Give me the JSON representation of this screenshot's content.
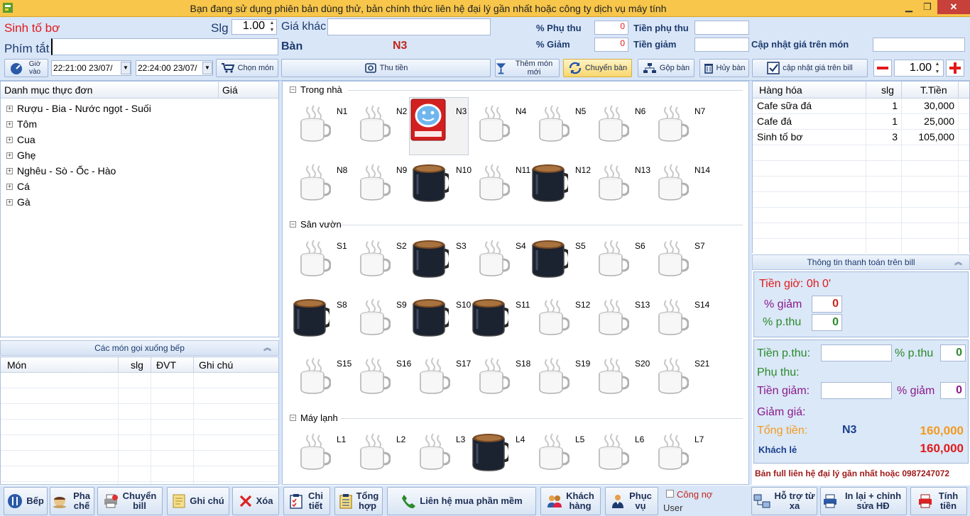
{
  "window": {
    "title": "Bạn đang sử dụng phiên bản dùng thử, bản chính thức liên hệ đại lý gần nhất hoặc công ty dịch vụ máy tính"
  },
  "order_entry": {
    "item_name": "Sinh tố bơ",
    "qty_label": "Slg",
    "qty_value": "1.00",
    "hotkey_label": "Phím tắt",
    "hotkey_value": "",
    "other_price_label": "Giá khác",
    "other_price_value": "",
    "table_label": "Bàn",
    "table_value": "N3",
    "surcharge_pct_label": "% Phụ thu",
    "surcharge_pct_value": "0",
    "discount_pct_label": "% Giảm",
    "discount_pct_value": "0",
    "surcharge_amount_label": "Tiền phụ thu",
    "discount_amount_label": "Tiền  giảm",
    "update_price_label": "Cập nhật giá trên món",
    "checkin_label": "Giờ vào",
    "time_in": "22:21:00 23/07/",
    "time_out": "22:24:00 23/07/",
    "qty_right_value": "1.00"
  },
  "toolbar": {
    "choose_item": "Chọn món",
    "payment": "Thu tiền",
    "add_new_item": "Thêm món mới",
    "move_table": "Chuyển bàn",
    "merge_table": "Gộp bàn",
    "cancel_table": "Hủy bàn",
    "update_bill_price": "cập nhật giá trên bill"
  },
  "menu": {
    "col_category": "Danh mục thực đơn",
    "col_price": "Giá",
    "categories": [
      "Rượu - Bia - Nước ngọt - Suối",
      "Tôm",
      "Cua",
      "Ghẹ",
      "Nghêu - Sò - Ốc - Hào",
      "Cá",
      "Gà"
    ]
  },
  "kitchen": {
    "title": "Các món gọi xuống bếp",
    "col_item": "Món",
    "col_qty": "slg",
    "col_unit": "ĐVT",
    "col_note": "Ghi chú"
  },
  "areas": [
    {
      "name": "Trong nhà",
      "tables": [
        {
          "name": "N1",
          "status": "empty"
        },
        {
          "name": "N2",
          "status": "empty"
        },
        {
          "name": "N3",
          "status": "selected"
        },
        {
          "name": "N4",
          "status": "empty"
        },
        {
          "name": "N5",
          "status": "empty"
        },
        {
          "name": "N6",
          "status": "empty"
        },
        {
          "name": "N7",
          "status": "empty"
        },
        {
          "name": "N8",
          "status": "empty"
        },
        {
          "name": "N9",
          "status": "empty"
        },
        {
          "name": "N10",
          "status": "occupied"
        },
        {
          "name": "N11",
          "status": "empty"
        },
        {
          "name": "N12",
          "status": "occupied"
        },
        {
          "name": "N13",
          "status": "empty"
        },
        {
          "name": "N14",
          "status": "empty"
        }
      ]
    },
    {
      "name": "Sân vườn",
      "tables": [
        {
          "name": "S1",
          "status": "empty"
        },
        {
          "name": "S2",
          "status": "empty"
        },
        {
          "name": "S3",
          "status": "occupied"
        },
        {
          "name": "S4",
          "status": "empty"
        },
        {
          "name": "S5",
          "status": "occupied"
        },
        {
          "name": "S6",
          "status": "empty"
        },
        {
          "name": "S7",
          "status": "empty"
        },
        {
          "name": "S8",
          "status": "occupied"
        },
        {
          "name": "S9",
          "status": "empty"
        },
        {
          "name": "S10",
          "status": "occupied"
        },
        {
          "name": "S11",
          "status": "occupied"
        },
        {
          "name": "S12",
          "status": "empty"
        },
        {
          "name": "S13",
          "status": "empty"
        },
        {
          "name": "S14",
          "status": "empty"
        },
        {
          "name": "S15",
          "status": "empty"
        },
        {
          "name": "S16",
          "status": "empty"
        },
        {
          "name": "S17",
          "status": "empty"
        },
        {
          "name": "S18",
          "status": "empty"
        },
        {
          "name": "S19",
          "status": "empty"
        },
        {
          "name": "S20",
          "status": "empty"
        },
        {
          "name": "S21",
          "status": "empty"
        }
      ]
    },
    {
      "name": "Máy lạnh",
      "tables": [
        {
          "name": "L1",
          "status": "empty"
        },
        {
          "name": "L2",
          "status": "empty"
        },
        {
          "name": "L3",
          "status": "empty"
        },
        {
          "name": "L4",
          "status": "occupied"
        },
        {
          "name": "L5",
          "status": "empty"
        },
        {
          "name": "L6",
          "status": "empty"
        },
        {
          "name": "L7",
          "status": "empty"
        }
      ]
    }
  ],
  "bill": {
    "col_item": "Hàng hóa",
    "col_qty": "slg",
    "col_total": "T.Tiền",
    "rows": [
      {
        "item": "Cafe sữa đá",
        "qty": "1",
        "total": "30,000"
      },
      {
        "item": "Cafe đá",
        "qty": "1",
        "total": "25,000"
      },
      {
        "item": "Sinh tố bơ",
        "qty": "3",
        "total": "105,000"
      }
    ]
  },
  "payment_info": {
    "title": "Thông tin thanh toán trên bill",
    "time_label": "Tiền giờ: 0h 0'",
    "discount_pct_label": "% giảm",
    "discount_pct_value": "0",
    "surcharge_pct_label": "% p.thu",
    "surcharge_pct_value": "0",
    "surcharge_money_label": "Tiền p.thu:",
    "surcharge_pct2_label": "% p.thu",
    "surcharge_pct2_value": "0",
    "surcharge_label": "Phụ thu:",
    "discount_money_label": "Tiền giảm:",
    "discount_pct2_label": "% giảm",
    "discount_pct2_value": "0",
    "reduce_label": "Giảm giá:",
    "total_label": "Tổng tiền:",
    "total_table": "N3",
    "total_value": "160,000",
    "customer_label": "Khách lẻ",
    "customer_value": "160,000",
    "footer": "Bản full liên hệ đại lý gần nhất hoặc 0987247072"
  },
  "bottom": {
    "kitchen": "Bếp",
    "bartender": "Pha chế",
    "transfer_bill": "Chuyển bill",
    "note": "Ghi chú",
    "delete": "Xóa",
    "detail": "Chi tiết",
    "summary": "Tổng hợp",
    "buy": "Liên hệ mua phần mềm",
    "customer": "Khách hàng",
    "server": "Phục vụ",
    "debt": "Công nợ",
    "user": "User",
    "remote": "Hỗ trợ từ xa",
    "reprint": "In lại + chỉnh sửa HĐ",
    "checkout": "Tính tiền"
  },
  "colors": {
    "accent_red": "#e11a1a",
    "total_orange": "#f39a1e",
    "brand_blue": "#1a3f8c"
  }
}
